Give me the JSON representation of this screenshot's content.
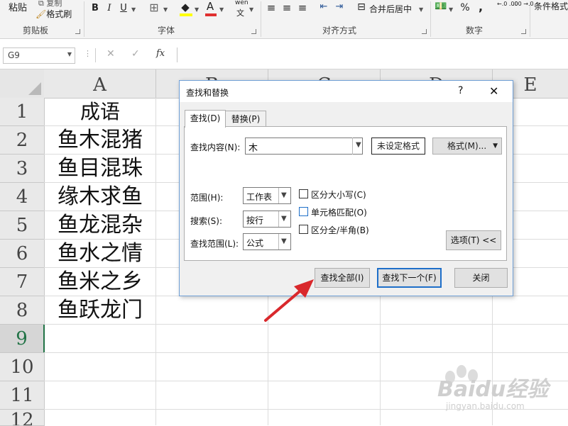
{
  "ribbon": {
    "paste_label": "粘贴",
    "copy_label": "复制",
    "format_painter_label": "格式刷",
    "bold": "B",
    "italic": "I",
    "underline": "U",
    "phonetic": "wén",
    "phonetic_sub": "文",
    "merge_center": "合并后居中",
    "percent": "%",
    "comma": ",",
    "dec_inc": "←.0 .00",
    "dec_dec": ".00 →.0",
    "conditional_format": "条件格式",
    "groups": {
      "clipboard": "剪贴板",
      "font": "字体",
      "alignment": "对齐方式",
      "number": "数字"
    }
  },
  "formula_bar": {
    "name_box": "G9",
    "cancel": "✕",
    "enter": "✓",
    "fx": "fx",
    "value": ""
  },
  "sheet": {
    "columns": [
      "A",
      "B",
      "C",
      "D",
      "E"
    ],
    "rows": [
      "1",
      "2",
      "3",
      "4",
      "5",
      "6",
      "7",
      "8",
      "9",
      "10",
      "11",
      "12"
    ],
    "selected_row": "9",
    "selected_cell": "G9",
    "column_a": [
      "成语",
      "鱼木混猪",
      "鱼目混珠",
      "缘木求鱼",
      "鱼龙混杂",
      "鱼水之情",
      "鱼米之乡",
      "鱼跃龙门"
    ]
  },
  "dialog": {
    "title": "查找和替换",
    "help": "?",
    "close": "✕",
    "tabs": {
      "find": "查找(D)",
      "replace": "替换(P)"
    },
    "find_label": "查找内容(N):",
    "find_value": "木",
    "no_format": "未设定格式",
    "format_button": "格式(M)...",
    "scope_label": "范围(H):",
    "scope_value": "工作表",
    "search_label": "搜索(S):",
    "search_value": "按行",
    "lookin_label": "查找范围(L):",
    "lookin_value": "公式",
    "match_case": "区分大小写(C)",
    "match_entire": "单元格匹配(O)",
    "match_byte": "区分全/半角(B)",
    "options_button": "选项(T) <<",
    "find_all": "查找全部(I)",
    "find_next": "查找下一个(F)",
    "close_button": "关闭"
  },
  "watermark": {
    "text": "Baidu经验",
    "url": "jingyan.baidu.com"
  },
  "colors": {
    "accent_green": "#217346",
    "arrow_red": "#d9282c",
    "dialog_border": "#6f9fd6"
  }
}
